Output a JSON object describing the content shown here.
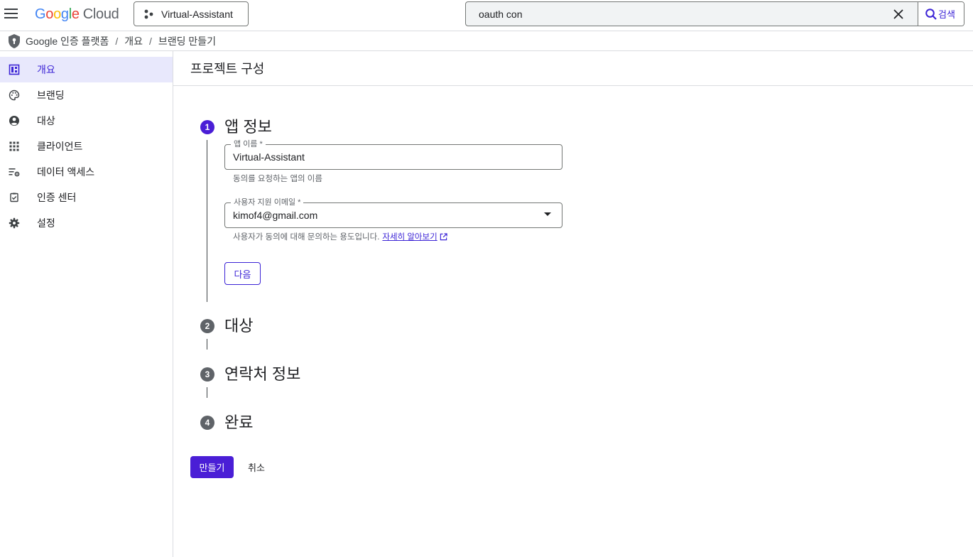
{
  "header": {
    "logo": {
      "google_letters": [
        "G",
        "o",
        "o",
        "g",
        "l",
        "e"
      ],
      "cloud": "Cloud"
    },
    "project": {
      "name": "Virtual-Assistant"
    },
    "search": {
      "value": "oauth con",
      "button_label": "검색"
    }
  },
  "breadcrumb": {
    "items": [
      "Google 인증 플랫폼",
      "개요",
      "브랜딩 만들기"
    ],
    "separator": "/"
  },
  "sidebar": {
    "items": [
      {
        "label": "개요",
        "icon": "dashboard-icon",
        "active": true
      },
      {
        "label": "브랜딩",
        "icon": "palette-icon",
        "active": false
      },
      {
        "label": "대상",
        "icon": "account-circle-icon",
        "active": false
      },
      {
        "label": "클라이언트",
        "icon": "apps-grid-icon",
        "active": false
      },
      {
        "label": "데이터 액세스",
        "icon": "data-settings-icon",
        "active": false
      },
      {
        "label": "인증 센터",
        "icon": "verified-check-icon",
        "active": false
      },
      {
        "label": "설정",
        "icon": "gear-icon",
        "active": false
      }
    ]
  },
  "main": {
    "title": "프로젝트 구성",
    "steps": [
      {
        "number": "1",
        "title": "앱 정보",
        "active": true
      },
      {
        "number": "2",
        "title": "대상",
        "active": false
      },
      {
        "number": "3",
        "title": "연락처 정보",
        "active": false
      },
      {
        "number": "4",
        "title": "완료",
        "active": false
      }
    ],
    "app_name_field": {
      "label": "앱 이름 *",
      "value": "Virtual-Assistant",
      "hint": "동의를 요청하는 앱의 이름"
    },
    "support_email_field": {
      "label": "사용자 지원 이메일 *",
      "value": "kimof4@gmail.com",
      "hint": "사용자가 동의에 대해 문의하는 용도입니다.",
      "link": "자세히 알아보기"
    },
    "next_button": "다음",
    "create_button": "만들기",
    "cancel_button": "취소"
  },
  "colors": {
    "accent": "#3c24d6",
    "accent_fill": "#4a1ed6",
    "active_nav_bg": "#e8e8fc"
  }
}
